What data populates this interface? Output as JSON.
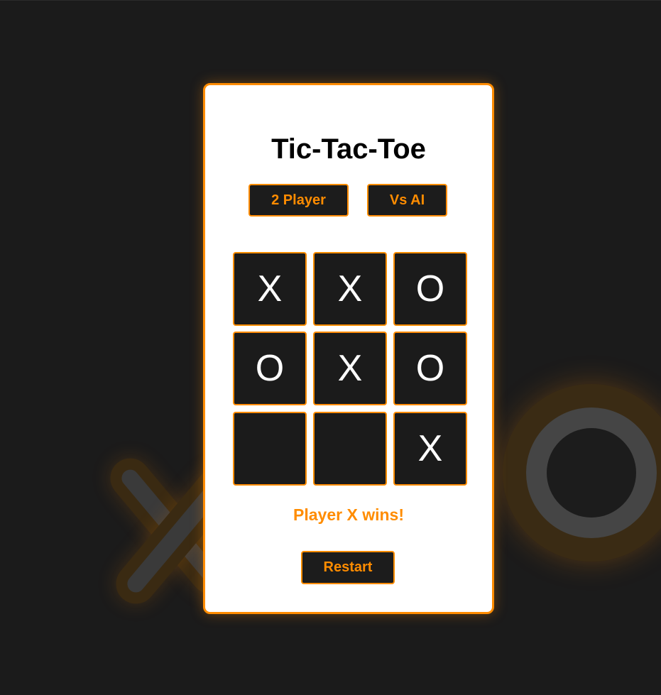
{
  "game": {
    "title": "Tic-Tac-Toe",
    "modes": [
      "2 Player",
      "Vs AI"
    ],
    "board": [
      "X",
      "X",
      "O",
      "O",
      "X",
      "O",
      "",
      "",
      "X"
    ],
    "status": "Player X wins!",
    "restart_label": "Restart"
  },
  "colors": {
    "accent": "#ff8c00",
    "background": "#1b1b1b",
    "card": "#ffffff",
    "cell": "#1b1b1b",
    "mark": "#ffffff"
  }
}
